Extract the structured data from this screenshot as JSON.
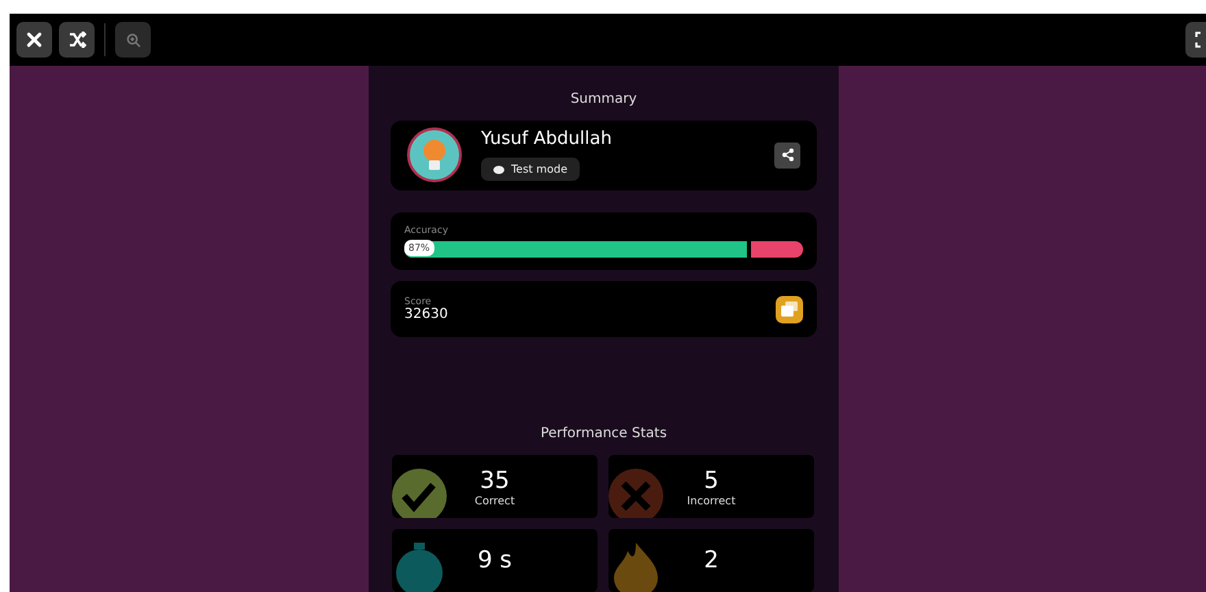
{
  "toolbar": {
    "buttons": [
      {
        "kind": "close"
      },
      {
        "kind": "shuffle"
      },
      {
        "kind": "zoom",
        "disabled": true
      }
    ],
    "right_buttons": [
      {
        "kind": "fullscreen"
      }
    ]
  },
  "summary": {
    "title": "Summary",
    "player": {
      "name": "Yusuf Abdullah",
      "mode": "Test mode"
    },
    "accuracy": {
      "label": "Accuracy",
      "reading": "87%",
      "level": 0.87
    },
    "score": {
      "label": "Score",
      "value": "32630"
    }
  },
  "performance": {
    "title": "Performance Stats",
    "stats": [
      {
        "kind": "correct",
        "value": "35",
        "label": "Correct"
      },
      {
        "kind": "incorrect",
        "value": "5",
        "label": "Incorrect"
      },
      {
        "kind": "time",
        "value": "9 s"
      },
      {
        "kind": "streak",
        "value": "2"
      }
    ]
  }
}
